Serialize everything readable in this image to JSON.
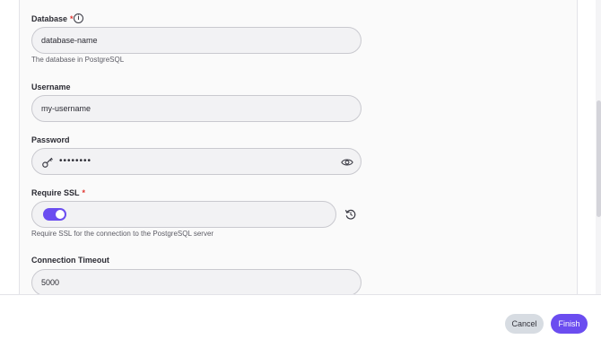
{
  "form": {
    "database": {
      "label": "Database",
      "required_mark": "*",
      "value": "database-name",
      "helper": "The database in PostgreSQL",
      "info_icon": "info-icon"
    },
    "username": {
      "label": "Username",
      "value": "my-username"
    },
    "password": {
      "label": "Password",
      "masked_value": "••••••••",
      "leading_icon": "key-icon",
      "trailing_icon": "eye-icon"
    },
    "require_ssl": {
      "label": "Require SSL",
      "required_mark": "*",
      "enabled": true,
      "helper": "Require SSL for the connection to the PostgreSQL server",
      "reset_icon": "reset-icon"
    },
    "connection_timeout": {
      "label": "Connection Timeout",
      "value": "5000"
    }
  },
  "footer": {
    "cancel_label": "Cancel",
    "finish_label": "Finish"
  },
  "colors": {
    "accent": "#6b4df0",
    "required": "#e0342f",
    "cancel_bg": "#d7dce2"
  }
}
